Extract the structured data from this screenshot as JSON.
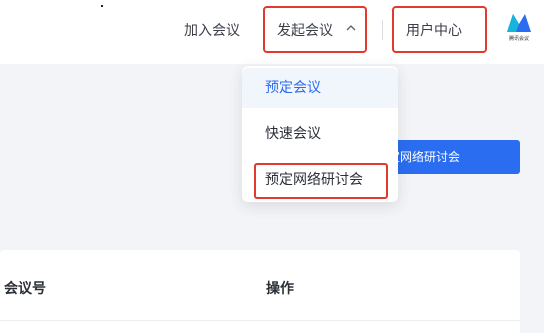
{
  "header": {
    "join_label": "加入会议",
    "start_label": "发起会议",
    "user_center_label": "用户中心",
    "logo_caption": "腾讯会议",
    "brand_color": "#2a6df0"
  },
  "dropdown": {
    "items": [
      {
        "label": "预定会议",
        "active": true
      },
      {
        "label": "快速会议"
      },
      {
        "label": "预定网络研讨会"
      }
    ]
  },
  "main": {
    "primary_button_label": "预定网络研讨会"
  },
  "table": {
    "columns": [
      "会议号",
      "操作"
    ]
  },
  "colors": {
    "highlight": "#e03a2f",
    "active_text": "#2a6df0"
  }
}
